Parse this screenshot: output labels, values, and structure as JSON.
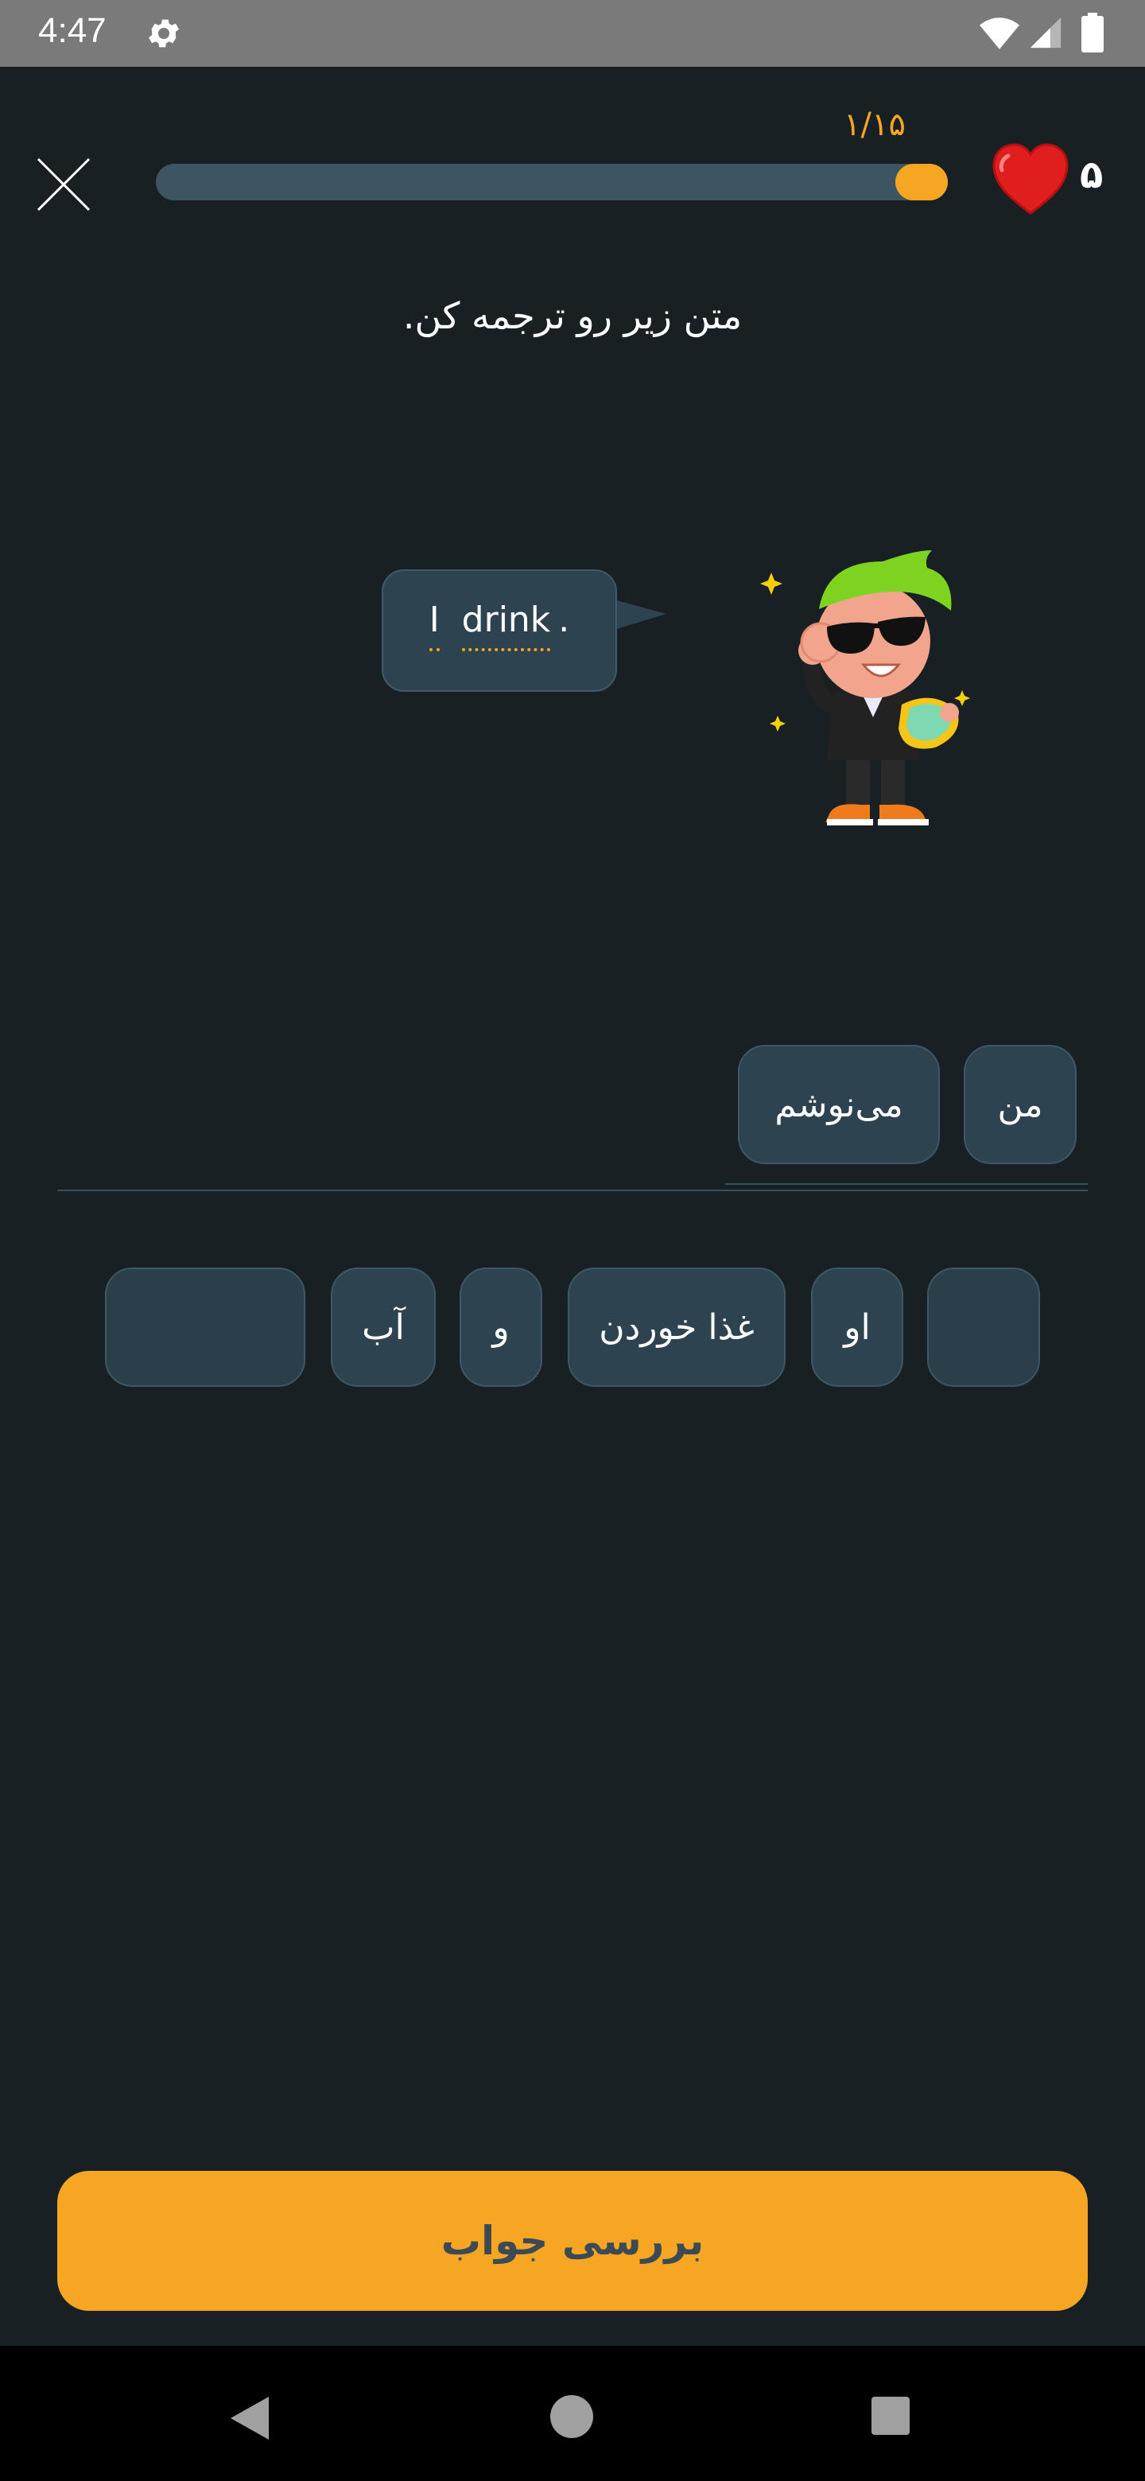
{
  "status_bar": {
    "time": "4:47",
    "icons": [
      "gear-icon",
      "wifi-icon",
      "signal-icon",
      "battery-icon"
    ]
  },
  "header": {
    "close_icon": "close-icon",
    "progress": {
      "label": "۱/۱۵",
      "fraction": 0.0667
    },
    "lives": "۵",
    "heart_icon": "heart-icon"
  },
  "instruction": "متن زیر رو ترجمه کن.",
  "bubble": {
    "words": [
      "I",
      "drink",
      "."
    ]
  },
  "answer": {
    "selected": [
      "من",
      "می‌نوشم"
    ]
  },
  "word_bank": {
    "chips": [
      "",
      "او",
      "غذا خوردن",
      "و",
      "آب",
      ""
    ]
  },
  "check_button": {
    "label": "بررسی جواب"
  },
  "colors": {
    "background": "#182024",
    "accent": "#f6a623",
    "chip": "#2d4450",
    "heart": "#e01e1e"
  }
}
